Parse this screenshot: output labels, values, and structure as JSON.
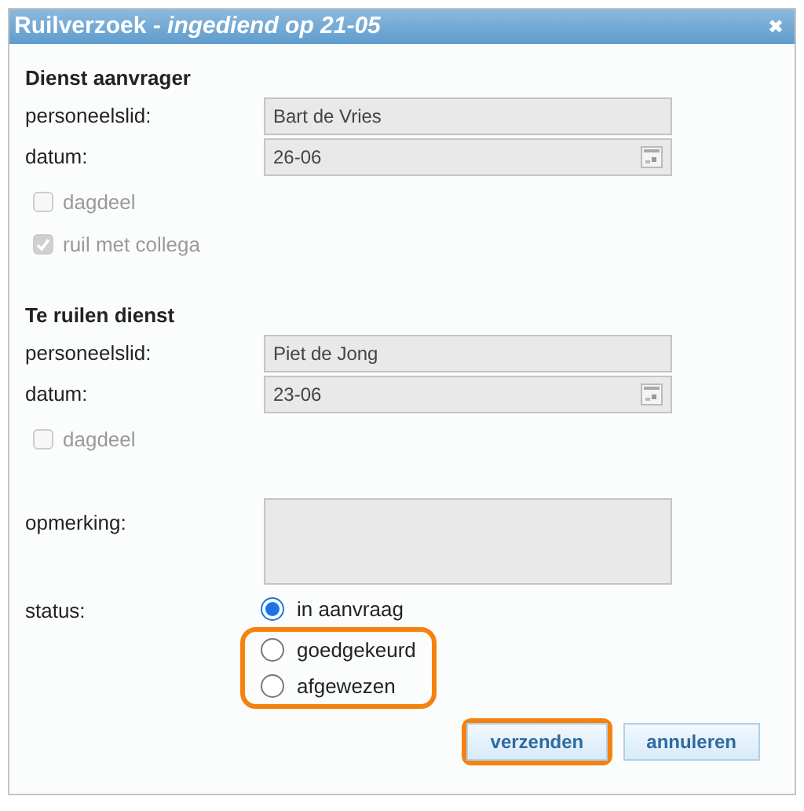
{
  "window": {
    "title": "Ruilverzoek - ",
    "title_suffix": "ingediend op 21-05",
    "close": "✖"
  },
  "sections": [
    {
      "heading": "Dienst aanvrager",
      "fields": [
        {
          "label": "personeelslid:",
          "value": "Bart de Vries",
          "kind": "text"
        },
        {
          "label": "datum:",
          "value": "26-06",
          "kind": "date"
        }
      ],
      "checkboxes": [
        {
          "label": "dagdeel",
          "checked": false,
          "disabled": true
        },
        {
          "label": "ruil met collega",
          "checked": true,
          "disabled": true
        }
      ]
    },
    {
      "heading": "Te ruilen dienst",
      "fields": [
        {
          "label": "personeelslid:",
          "value": "Piet de Jong",
          "kind": "text"
        },
        {
          "label": "datum:",
          "value": "23-06",
          "kind": "date"
        }
      ],
      "checkboxes": [
        {
          "label": "dagdeel",
          "checked": false,
          "disabled": true
        }
      ]
    }
  ],
  "remark": {
    "label": "opmerking:"
  },
  "status": {
    "label": "status:",
    "options": [
      {
        "label": "in aanvraag",
        "selected": true,
        "highlighted": false
      },
      {
        "label": "goedgekeurd",
        "selected": false,
        "highlighted": true
      },
      {
        "label": "afgewezen",
        "selected": false,
        "highlighted": true
      }
    ]
  },
  "buttons": [
    {
      "label": "verzenden",
      "highlighted": true
    },
    {
      "label": "annuleren",
      "highlighted": false
    }
  ]
}
